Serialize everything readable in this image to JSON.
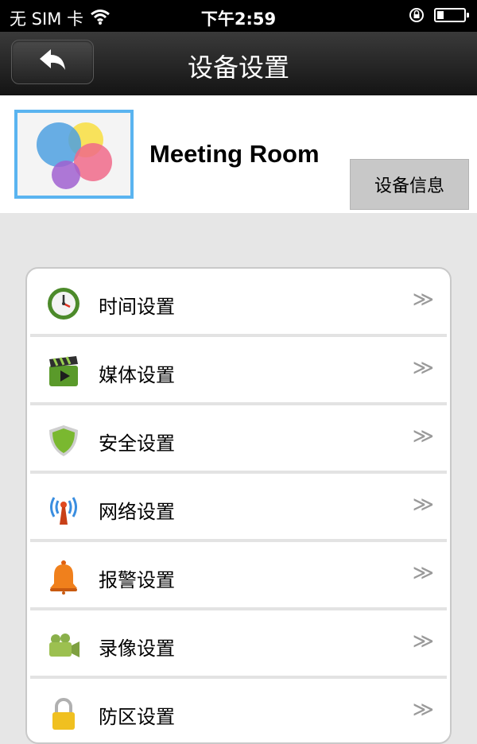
{
  "status_bar": {
    "carrier": "无 SIM 卡",
    "time": "下午2:59",
    "battery_level": 0.25
  },
  "nav": {
    "title": "设备设置",
    "back_icon": "back-arrow-icon"
  },
  "device": {
    "name": "Meeting Room",
    "info_button_label": "设备信息",
    "thumbnail_icon": "game-center-bubbles-icon"
  },
  "settings": {
    "items": [
      {
        "label": "时间设置",
        "icon": "clock-icon",
        "chevron": "≫"
      },
      {
        "label": "媒体设置",
        "icon": "clapperboard-icon",
        "chevron": "≫"
      },
      {
        "label": "安全设置",
        "icon": "shield-icon",
        "chevron": "≫"
      },
      {
        "label": "网络设置",
        "icon": "antenna-icon",
        "chevron": "≫"
      },
      {
        "label": "报警设置",
        "icon": "bell-icon",
        "chevron": "≫"
      },
      {
        "label": "录像设置",
        "icon": "video-camera-icon",
        "chevron": "≫"
      },
      {
        "label": "防区设置",
        "icon": "padlock-icon",
        "chevron": "≫"
      }
    ]
  },
  "colors": {
    "thumbnail_border": "#5ab4f0",
    "nav_background": "#1e1e1e",
    "list_background": "#e6e6e6"
  }
}
